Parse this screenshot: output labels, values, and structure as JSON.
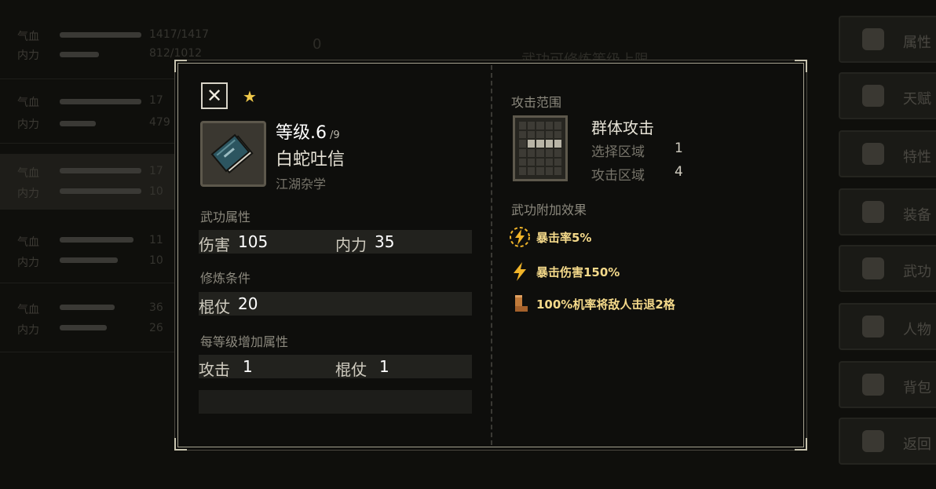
{
  "dialog": {
    "level_label": "等级.6",
    "level_max": "/9",
    "skill_name": "白蛇吐信",
    "skill_type": "江湖杂学",
    "sections": {
      "attributes": "武功属性",
      "requirements": "修炼条件",
      "per_level": "每等级增加属性",
      "range": "攻击范围",
      "effects": "武功附加效果"
    },
    "attributes": [
      {
        "label": "伤害",
        "value": "105"
      },
      {
        "label": "内力",
        "value": "35"
      }
    ],
    "requirements": [
      {
        "label": "棍仗",
        "value": "20"
      }
    ],
    "per_level": [
      {
        "label": "攻击",
        "value": "1"
      },
      {
        "label": "棍仗",
        "value": "1"
      }
    ],
    "range": {
      "name": "群体攻击",
      "select_label": "选择区域",
      "select_value": "1",
      "attack_label": "攻击区域",
      "attack_value": "4"
    },
    "effects": [
      {
        "icon": "lightning-circle-icon",
        "text": "暴击率5%",
        "color": "#f0b429"
      },
      {
        "icon": "lightning-icon",
        "text": "暴击伤害150%",
        "color": "#f0b429"
      },
      {
        "icon": "boot-icon",
        "text": "100%机率将敌人击退2格",
        "color": "#c07a3a"
      }
    ]
  },
  "background": {
    "left_rows": [
      {
        "hp_label": "气血",
        "mp_label": "内力",
        "hp": "1417/1417",
        "mp": "812/1012"
      },
      {
        "hp_label": "气血",
        "mp_label": "内力",
        "hp": "17",
        "mp": "479"
      },
      {
        "hp_label": "气血",
        "mp_label": "内力",
        "hp": "17",
        "mp": "10"
      },
      {
        "hp_label": "气血",
        "mp_label": "内力",
        "hp": "11",
        "mp": "10"
      },
      {
        "hp_label": "气血",
        "mp_label": "内力",
        "hp": "36",
        "mp": "26"
      }
    ],
    "side_menu": [
      "属性",
      "天赋",
      "特性",
      "装备",
      "武功",
      "人物",
      "背包",
      "返回"
    ],
    "center_top": "武功可修炼等级上限",
    "coin_count": "0"
  },
  "colors": {
    "accent_gold": "#f0c94a",
    "effect_text": "#f4d98a",
    "frame": "#a5a290"
  }
}
